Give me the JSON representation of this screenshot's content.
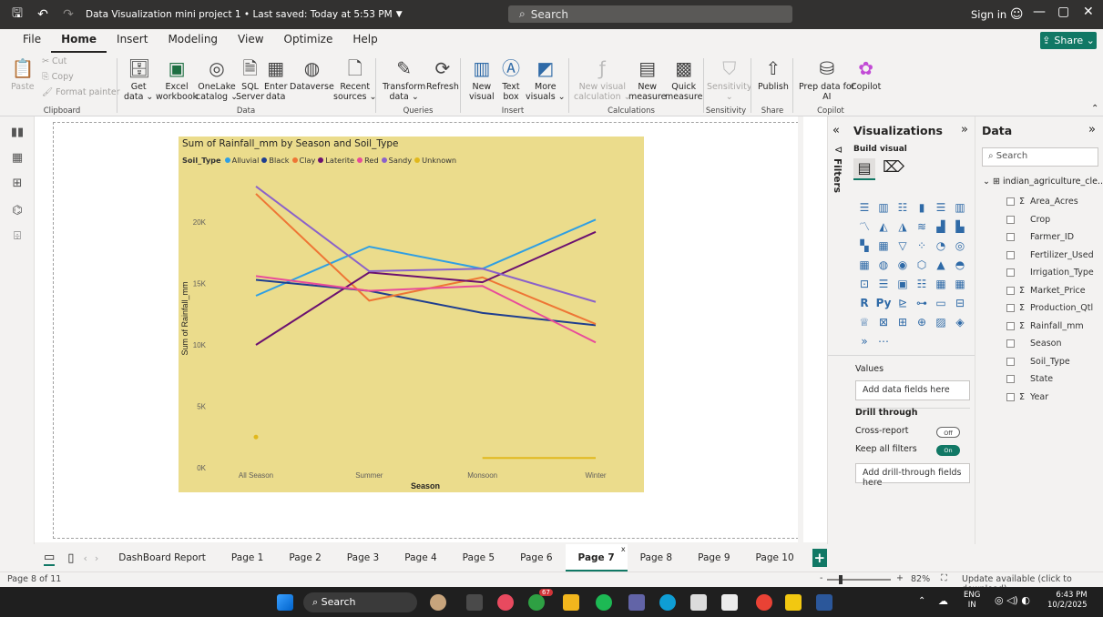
{
  "titlebar": {
    "doc_title": "Data Visualization mini project 1 • Last saved: Today at 5:53 PM",
    "search_placeholder": "Search",
    "sign_in": "Sign in"
  },
  "menu": {
    "items": [
      "File",
      "Home",
      "Insert",
      "Modeling",
      "View",
      "Optimize",
      "Help"
    ],
    "active": "Home",
    "share": "Share"
  },
  "ribbon": {
    "clipboard": {
      "paste": "Paste",
      "cut": "Cut",
      "copy": "Copy",
      "format_painter": "Format painter",
      "group": "Clipboard"
    },
    "data": {
      "buttons": [
        {
          "l1": "Get",
          "l2": "data ⌄"
        },
        {
          "l1": "Excel",
          "l2": "workbook"
        },
        {
          "l1": "OneLake",
          "l2": "catalog ⌄"
        },
        {
          "l1": "SQL",
          "l2": "Server"
        },
        {
          "l1": "Enter",
          "l2": "data"
        },
        {
          "l1": "Dataverse",
          "l2": ""
        },
        {
          "l1": "Recent",
          "l2": "sources ⌄"
        }
      ],
      "group": "Data"
    },
    "queries": {
      "transform": {
        "l1": "Transform",
        "l2": "data ⌄"
      },
      "refresh": "Refresh",
      "group": "Queries"
    },
    "insert": {
      "buttons": [
        {
          "l1": "New",
          "l2": "visual"
        },
        {
          "l1": "Text",
          "l2": "box"
        },
        {
          "l1": "More",
          "l2": "visuals ⌄"
        }
      ],
      "group": "Insert"
    },
    "calculations": {
      "buttons": [
        {
          "l1": "New visual",
          "l2": "calculation ⌄"
        },
        {
          "l1": "New",
          "l2": "measure"
        },
        {
          "l1": "Quick",
          "l2": "measure"
        }
      ],
      "group": "Calculations"
    },
    "sensitivity": {
      "label": "Sensitivity",
      "sub": "⌄",
      "group": "Sensitivity"
    },
    "share": {
      "label": "Publish",
      "group": "Share"
    },
    "copilot": {
      "l1": "Prep data for",
      "l2": "AI",
      "copilot": "Copilot",
      "group": "Copilot"
    }
  },
  "chart_data": {
    "type": "line",
    "title": "Sum of Rainfall_mm by Season and Soil_Type",
    "legend_title": "Soil_Type",
    "legend_position": "top-left",
    "xlabel": "Season",
    "ylabel": "Sum of Rainfall_mm",
    "categories": [
      "All Season",
      "Summer",
      "Monsoon",
      "Winter"
    ],
    "yticks": [
      "0K",
      "5K",
      "10K",
      "15K",
      "20K"
    ],
    "ylim": [
      0,
      24000
    ],
    "grid": false,
    "series": [
      {
        "name": "Alluvial",
        "color": "#2f9fe3",
        "values": [
          14000,
          18000,
          16200,
          20200
        ]
      },
      {
        "name": "Black",
        "color": "#1f3e8f",
        "values": [
          15300,
          14400,
          12600,
          11600
        ]
      },
      {
        "name": "Clay",
        "color": "#ee7635",
        "values": [
          22300,
          13600,
          15500,
          11700
        ]
      },
      {
        "name": "Laterite",
        "color": "#6b1170",
        "values": [
          10000,
          15900,
          15100,
          19200
        ]
      },
      {
        "name": "Red",
        "color": "#e84c9a",
        "values": [
          15600,
          14400,
          14800,
          10200
        ]
      },
      {
        "name": "Sandy",
        "color": "#8b62c9",
        "values": [
          22900,
          16000,
          16200,
          13500
        ]
      },
      {
        "name": "Unknown",
        "color": "#e1b81c",
        "values": [
          2500,
          null,
          800,
          800
        ]
      }
    ]
  },
  "visualizations": {
    "title": "Visualizations",
    "build_visual": "Build visual",
    "filters_label": "Filters",
    "values_label": "Values",
    "values_placeholder": "Add data fields here",
    "drill_through": "Drill through",
    "cross_report": "Cross-report",
    "cross_report_state": "Off",
    "keep_filters": "Keep all filters",
    "keep_filters_state": "On",
    "drill_placeholder": "Add drill-through fields here"
  },
  "data_pane": {
    "title": "Data",
    "search_placeholder": "Search",
    "table": "indian_agriculture_cle...",
    "fields": [
      {
        "name": "Area_Acres",
        "sigma": true
      },
      {
        "name": "Crop",
        "sigma": false
      },
      {
        "name": "Farmer_ID",
        "sigma": false
      },
      {
        "name": "Fertilizer_Used",
        "sigma": false
      },
      {
        "name": "Irrigation_Type",
        "sigma": false
      },
      {
        "name": "Market_Price",
        "sigma": true
      },
      {
        "name": "Production_Qtl",
        "sigma": true
      },
      {
        "name": "Rainfall_mm",
        "sigma": true
      },
      {
        "name": "Season",
        "sigma": false
      },
      {
        "name": "Soil_Type",
        "sigma": false
      },
      {
        "name": "State",
        "sigma": false
      },
      {
        "name": "Year",
        "sigma": true
      }
    ]
  },
  "pages": {
    "tabs": [
      "DashBoard Report",
      "Page 1",
      "Page 2",
      "Page 3",
      "Page 4",
      "Page 5",
      "Page 6",
      "Page 7",
      "Page 8",
      "Page 9",
      "Page 10"
    ],
    "active": "Page 7"
  },
  "status": {
    "page_info": "Page 8 of 11",
    "zoom": "82%",
    "zoom_fraction": 0.18,
    "update": "Update available (click to download)"
  },
  "taskbar": {
    "search": "Search",
    "badge": "67",
    "lang1": "ENG",
    "lang2": "IN",
    "time": "6:43 PM",
    "date": "10/2/2025"
  },
  "colors": {
    "accent": "#117865",
    "chart_bg": "#ebdc8c",
    "titlebar": "#323130"
  }
}
